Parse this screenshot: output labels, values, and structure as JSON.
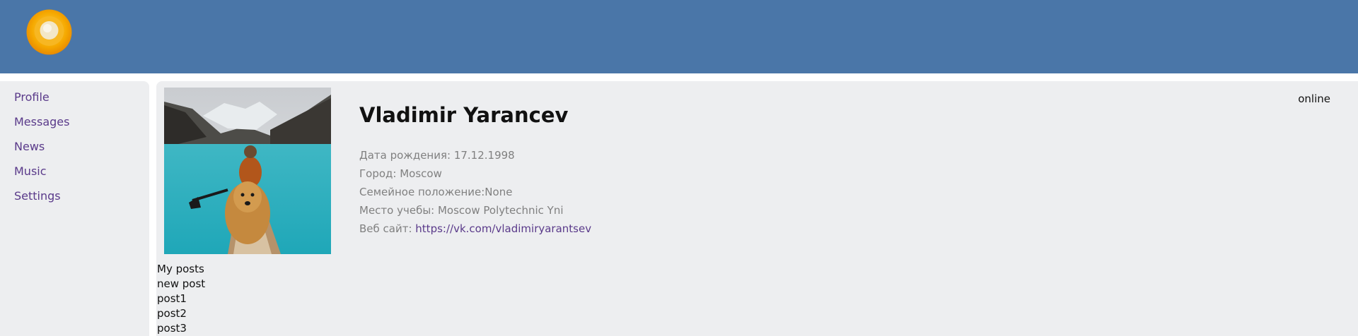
{
  "nav": {
    "items": [
      {
        "label": "Profile"
      },
      {
        "label": "Messages"
      },
      {
        "label": "News"
      },
      {
        "label": "Music"
      },
      {
        "label": "Settings"
      }
    ]
  },
  "profile": {
    "name": "Vladimir Yarancev",
    "status": "online",
    "info": {
      "birthday": "Дата рождения: 17.12.1998",
      "city": "Город: Moscow",
      "marital": "Семейное положение:None",
      "education": "Место учебы: Moscow Polytechnic Yni",
      "website_label": "Веб сайт: ",
      "website_url": "https://vk.com/vladimiryarantsev"
    }
  },
  "posts": {
    "title": "My posts",
    "new_post_label": "new post",
    "items": [
      "post1",
      "post2",
      "post3"
    ]
  },
  "colors": {
    "header": "#4a76a8",
    "panel": "#edeef0",
    "link": "#5a3a8a"
  }
}
